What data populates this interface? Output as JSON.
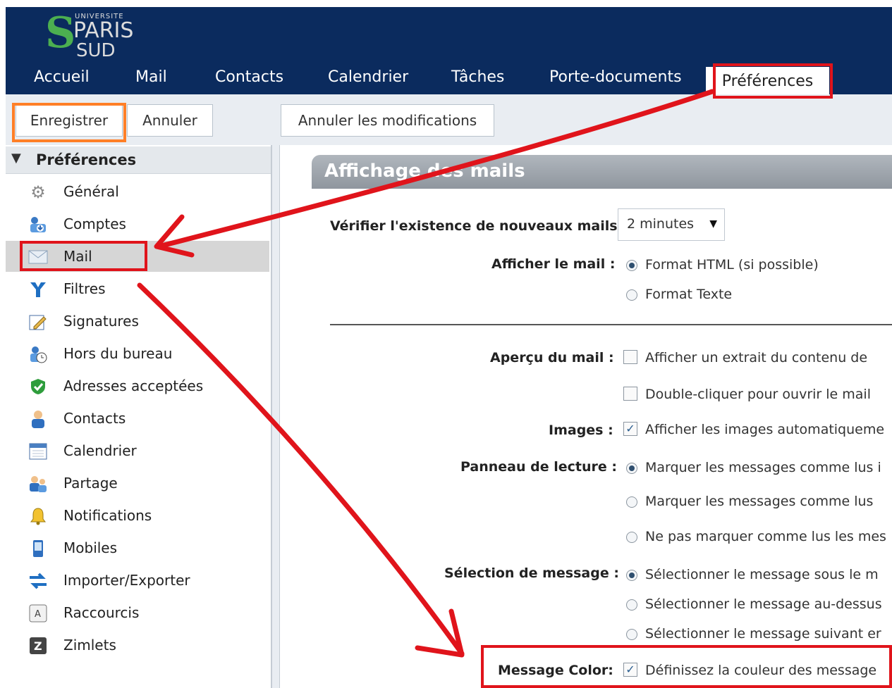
{
  "logo": {
    "univ": "UNIVERSITE",
    "paris": "PARIS",
    "sud": "SUD"
  },
  "nav": {
    "accueil": "Accueil",
    "mail": "Mail",
    "contacts": "Contacts",
    "calendrier": "Calendrier",
    "taches": "Tâches",
    "porte_documents": "Porte-documents",
    "preferences": "Préférences"
  },
  "toolbar": {
    "save": "Enregistrer",
    "cancel": "Annuler",
    "revert": "Annuler les modifications"
  },
  "sidebar": {
    "header": "Préférences",
    "items": [
      {
        "label": "Général",
        "icon": "gear-icon"
      },
      {
        "label": "Comptes",
        "icon": "accounts-icon"
      },
      {
        "label": "Mail",
        "icon": "envelope-icon"
      },
      {
        "label": "Filtres",
        "icon": "filter-icon"
      },
      {
        "label": "Signatures",
        "icon": "signature-icon"
      },
      {
        "label": "Hors du bureau",
        "icon": "out-of-office-icon"
      },
      {
        "label": "Adresses acceptées",
        "icon": "shield-check-icon"
      },
      {
        "label": "Contacts",
        "icon": "contact-person-icon"
      },
      {
        "label": "Calendrier",
        "icon": "calendar-icon"
      },
      {
        "label": "Partage",
        "icon": "sharing-icon"
      },
      {
        "label": "Notifications",
        "icon": "bell-icon"
      },
      {
        "label": "Mobiles",
        "icon": "mobile-phone-icon"
      },
      {
        "label": "Importer/Exporter",
        "icon": "import-export-icon"
      },
      {
        "label": "Raccourcis",
        "icon": "keyboard-icon"
      },
      {
        "label": "Zimlets",
        "icon": "zimlet-icon"
      }
    ]
  },
  "main": {
    "section_title": "Affichage des mails",
    "check_new": {
      "label": "Vérifier l'existence de nouveaux mails :",
      "value": "2 minutes"
    },
    "display": {
      "label": "Afficher le mail :",
      "opt_html": "Format HTML (si possible)",
      "opt_text": "Format Texte"
    },
    "preview": {
      "label": "Aperçu du mail :",
      "opt_excerpt": "Afficher un extrait du contenu de",
      "opt_dblclick": "Double-cliquer pour ouvrir le mail"
    },
    "images": {
      "label": "Images :",
      "opt": "Afficher les images automatiqueme"
    },
    "reading": {
      "label": "Panneau de lecture :",
      "opt1": "Marquer les messages comme lus i",
      "opt2": "Marquer les messages comme lus",
      "opt3": "Ne pas marquer comme lus les mes"
    },
    "selection": {
      "label": "Sélection de message :",
      "opt1": "Sélectionner le message sous le m",
      "opt2": "Sélectionner le message au-dessus",
      "opt3": "Sélectionner le message suivant er"
    },
    "color": {
      "label": "Message Color:",
      "opt": "Définissez la couleur des message"
    }
  },
  "colors": {
    "header_bg": "#0b2b5e",
    "highlight_red": "#e0141b",
    "highlight_orange": "#ff7f27"
  }
}
